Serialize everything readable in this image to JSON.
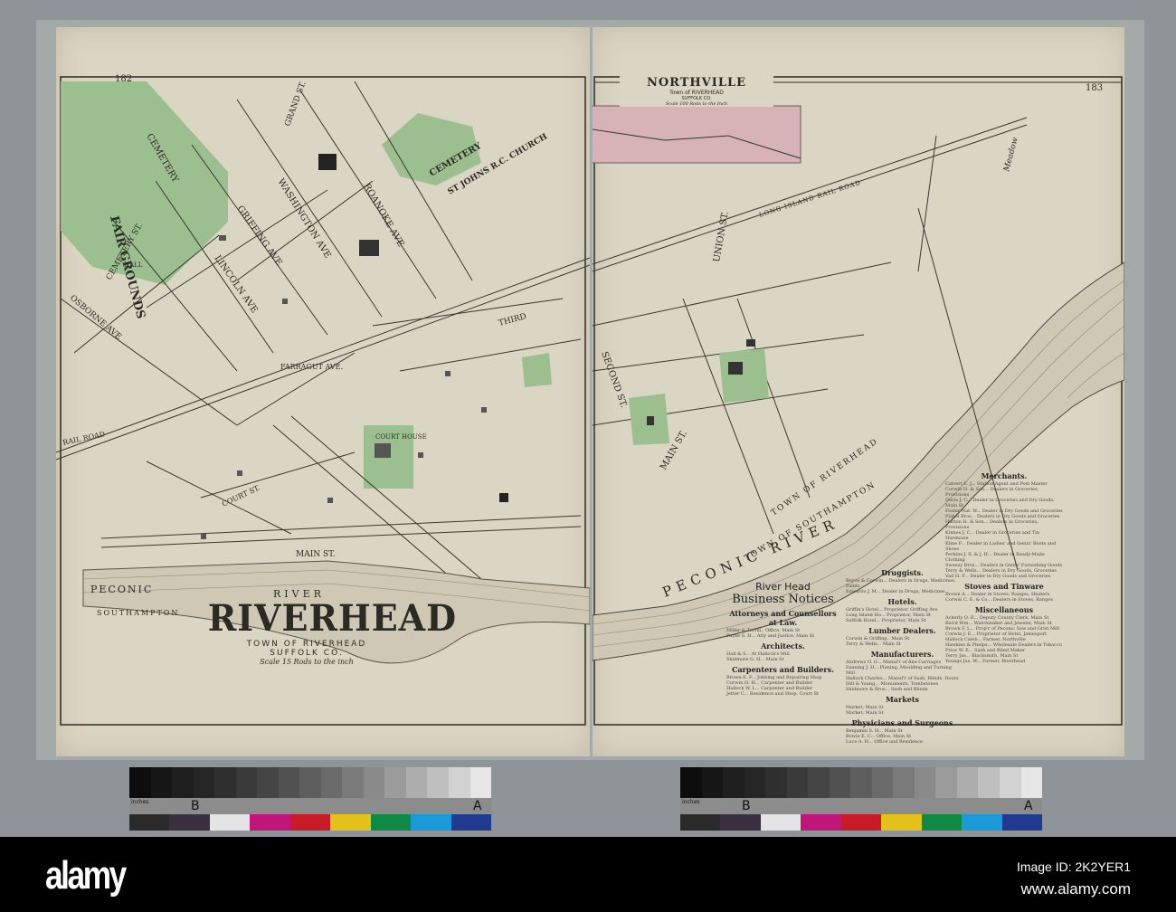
{
  "left_page": {
    "page_number": "182",
    "title": "RIVERHEAD",
    "subtitle": "TOWN OF RIVERHEAD",
    "county": "SUFFOLK CO.",
    "scale": "Scale 15 Rods to the inch",
    "labels": {
      "fair_grounds": "FAIR GROUNDS",
      "cemetery": "CEMETERY",
      "cemetery2": "CEMETERY",
      "church": "ST JOHNS R.C. CHURCH",
      "court_house": "COURT HOUSE",
      "hall": "HALL",
      "cemetery_st": "CEMETERY ST.",
      "griffing_ave": "GRIFFING AVE",
      "lincoln_ave": "LINCOLN AVE",
      "washington_ave": "WASHINGTON AVE",
      "roanoke_ave": "ROANOKE AVE",
      "grand_st": "GRAND ST.",
      "osborne_ave": "OSBORNE AVE",
      "farragut_ave": "FARRAGUT AVE.",
      "rail_road": "RAIL ROAD",
      "court_st": "COURT ST.",
      "main_st": "MAIN ST.",
      "third_st": "THIRD",
      "peconic": "PECONIC",
      "river": "RIVER",
      "southampton": "SOUTHAMPTON"
    }
  },
  "right_page": {
    "page_number": "183",
    "inset": {
      "title": "NORTHVILLE",
      "subtitle": "Town of RIVERHEAD",
      "county": "SUFFOLK CO.",
      "scale": "Scale 100 Rods to the Inch"
    },
    "labels": {
      "lirr": "LONG ISLAND RAIL ROAD",
      "union_st": "UNION ST.",
      "second_st": "SECOND ST.",
      "main_st": "MAIN ST.",
      "peconic_river": "PECONIC RIVER",
      "town_of_riverhead": "TOWN OF RIVERHEAD",
      "town_of_southampton": "TOWN OF SOUTHAMPTON",
      "meadow": "Meadow"
    },
    "business_notices": {
      "heading": "River Head",
      "title": "Business Notices",
      "sections": [
        "Attorneys and Counsellors at Law.",
        "Architects.",
        "Carpenters and Builders.",
        "Druggists.",
        "Hotels.",
        "Lumber Dealers.",
        "Manufacturers.",
        "Markets",
        "Physicians and Surgeons",
        "Merchants.",
        "Stoves and Tinware",
        "Miscellaneous"
      ]
    }
  },
  "color_chart": {
    "label_b": "B",
    "label_a": "A",
    "ruler_label": "inches",
    "swatches": [
      "#2a2a2a",
      "#3a3040",
      "#e4e4e4",
      "#c0157a",
      "#c81a28",
      "#e4c21a",
      "#0e8a45",
      "#1a9ad8",
      "#1f3a8e"
    ]
  },
  "watermark": {
    "logo": "alamy",
    "image_id": "Image ID: 2K2YER1",
    "url": "www.alamy.com"
  },
  "colors": {
    "paper": "#dbd5c3",
    "green": "#9cbf8f",
    "pink": "#d7b3b8",
    "ink": "#2c2a25"
  }
}
